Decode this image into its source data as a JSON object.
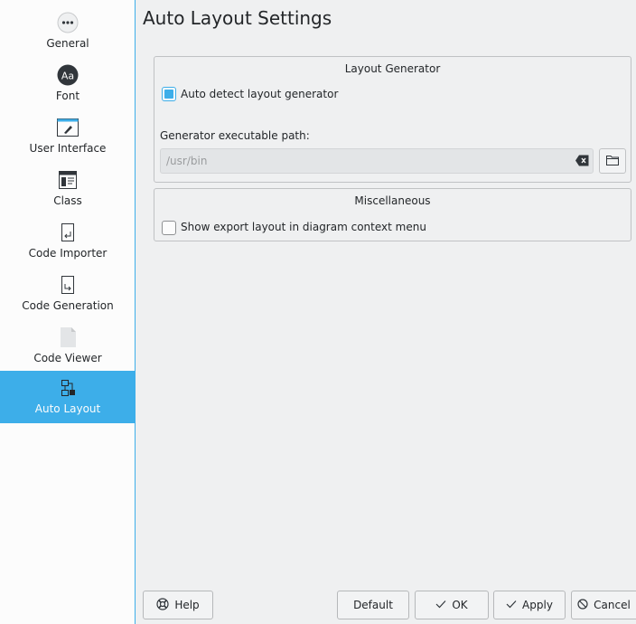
{
  "sidebar": {
    "items": [
      {
        "label": "General",
        "icon": "ellipsis-icon"
      },
      {
        "label": "Font",
        "icon": "font-icon"
      },
      {
        "label": "User Interface",
        "icon": "user-interface-icon"
      },
      {
        "label": "Class",
        "icon": "class-icon"
      },
      {
        "label": "Code Importer",
        "icon": "code-importer-icon"
      },
      {
        "label": "Code Generation",
        "icon": "code-generation-icon"
      },
      {
        "label": "Code Viewer",
        "icon": "code-viewer-icon"
      },
      {
        "label": "Auto Layout",
        "icon": "auto-layout-icon",
        "active": true
      }
    ],
    "font_icon_text": "Aa",
    "active_color": "#3daee9"
  },
  "main": {
    "title": "Auto Layout Settings",
    "layout_generator": {
      "title": "Layout Generator",
      "auto_detect_label": "Auto detect layout generator",
      "auto_detect_checked": true,
      "path_label": "Generator executable path:",
      "path_value": "/usr/bin"
    },
    "misc": {
      "title": "Miscellaneous",
      "export_label": "Show export layout in diagram context menu",
      "export_checked": false
    }
  },
  "buttons": {
    "help": "Help",
    "default": "Default",
    "ok": "OK",
    "apply": "Apply",
    "cancel": "Cancel"
  }
}
